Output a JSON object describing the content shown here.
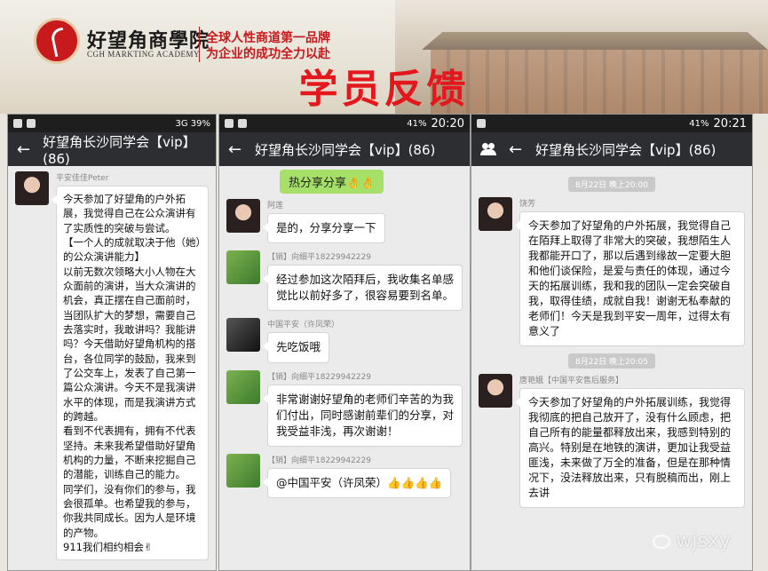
{
  "banner": {
    "brand_name": "好望角商學院",
    "brand_en": "CGH MARKTING ACADEMY",
    "slogan_line1": "全球人性商道第一品牌",
    "slogan_line2": "为企业的成功全力以赴",
    "title": "学员反馈"
  },
  "phone1": {
    "status": {
      "right": "3G 39%"
    },
    "messages": [
      {
        "sender": "平安佳佳Peter",
        "text": "今天参加了好望角的户外拓展，我觉得自己在公众演讲有了实质性的突破与尝试。\n【一个人的成就取决于他（她）的公众演讲能力】\n以前无数次领略大小人物在大众面前的演讲，当大众演讲的机会，真正摆在自己面前时，当团队扩大的梦想，需要自己去落实时，我敢讲吗？我能讲吗？今天借助好望角机构的搭台，各位同学的鼓励，我来到了公交车上，发表了自己第一篇公众演讲。今天不是我演讲水平的体现，而是我演讲方式的跨越。\n看到不代表拥有，拥有不代表坚持。未来我希望借助好望角机构的力量，不断来挖掘自己的潜能，训练自己的能力。\n同学们，没有你们的参与，我会很孤单。也希望我的参与，你我共同成长。因为人是环境的产物。\n911我们相约相会✌"
      }
    ]
  },
  "phone2": {
    "status": {
      "right": "41%",
      "time": "20:20"
    },
    "chat_title": "好望角长沙同学会【vip】(86)",
    "top_bubble": "热分享分享👌👌",
    "messages": [
      {
        "sender": "阿莲",
        "text": "是的，分享分享一下"
      },
      {
        "sender": "【销】向细平18229942229",
        "text": "经过参加这次陌拜后，我收集名单感觉比以前好多了，很容易要到名单。"
      },
      {
        "sender": "中国平安（许凤荣）",
        "text": "先吃饭哦"
      },
      {
        "sender": "【销】向细平18229942229",
        "text": "非常谢谢好望角的老师们辛苦的为我们付出，同时感谢前辈们的分享，对我受益非浅，再次谢谢！"
      },
      {
        "sender": "【销】向细平18229942229",
        "text": "@中国平安（许凤荣）👍👍👍👍"
      }
    ]
  },
  "phone3": {
    "status": {
      "right": "41%",
      "time": "20:21"
    },
    "chat_title": "好望角长沙同学会【vip】(86)",
    "timestamp1": "8月22日 晚上20:00",
    "timestamp2": "8月22日 晚上20:05",
    "messages": [
      {
        "sender": "饶芳",
        "text": "今天参加了好望角的户外拓展，我觉得自己在陌拜上取得了非常大的突破，我想陌生人我都能开口了，那以后遇到缘故一定要大胆和他们谈保险，是爱与责任的体现，通过今天的拓展训练，我和我的团队一定会突破自我，取得佳绩，成就自我！谢谢无私奉献的老师们！今天是我到平安一周年，过得太有意义了"
      },
      {
        "sender": "唐艳娥【中国平安售后服务】",
        "text": "今天参加了好望角的户外拓展训练，我觉得我彻底的把自己放开了，没有什么顾虑，把自己所有的能量都释放出来，我感到特别的高兴。特别是在地铁的演讲，更加让我受益匪浅，未来做了万全的准备，但是在那种情况下，没法释放出来，只有脱稿而出，刚上去讲"
      }
    ],
    "watermark": "wjsxy"
  },
  "phone1_title": "好望角长沙同学会【vip】(86)"
}
